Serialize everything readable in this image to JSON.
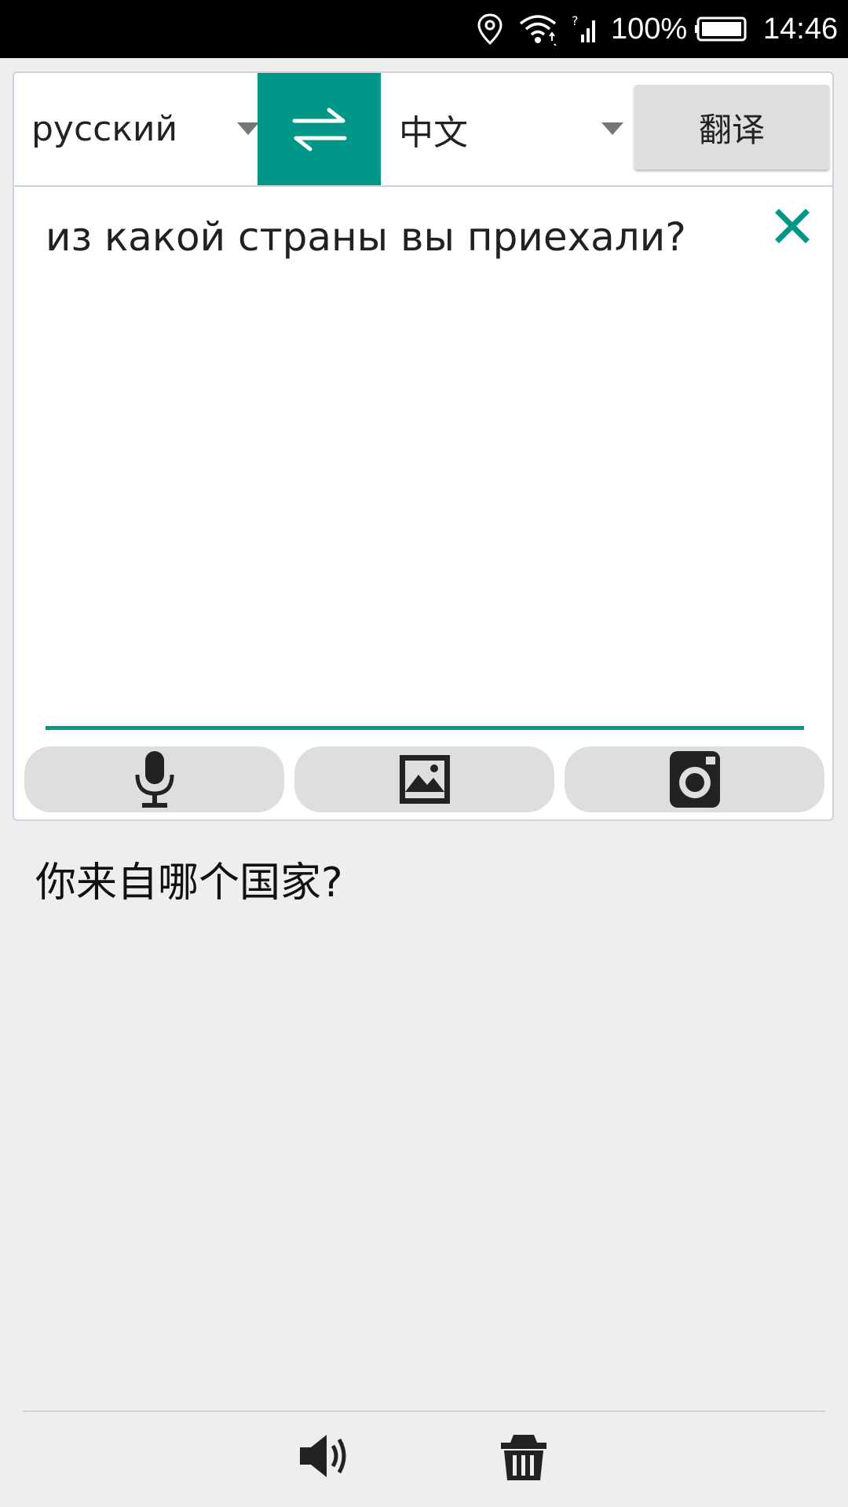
{
  "status_bar": {
    "battery_percent": "100%",
    "time": "14:46",
    "icons": [
      "location-icon",
      "wifi-icon",
      "signal-icon",
      "battery-icon"
    ]
  },
  "toolbar": {
    "source_language": "русский",
    "target_language": "中文",
    "translate_label": "翻译",
    "swap_icon": "swap-arrows-icon"
  },
  "input": {
    "text": "из какой страны вы приехали?"
  },
  "tools": {
    "icons": [
      "microphone-icon",
      "image-icon",
      "camera-icon"
    ]
  },
  "output": {
    "text": "你来自哪个国家?"
  },
  "bottom_bar": {
    "icons": [
      "speaker-icon",
      "trash-icon"
    ]
  },
  "colors": {
    "accent": "#009688",
    "background": "#eeeeee",
    "button_gray": "#dedede",
    "status_bar": "#000000"
  }
}
